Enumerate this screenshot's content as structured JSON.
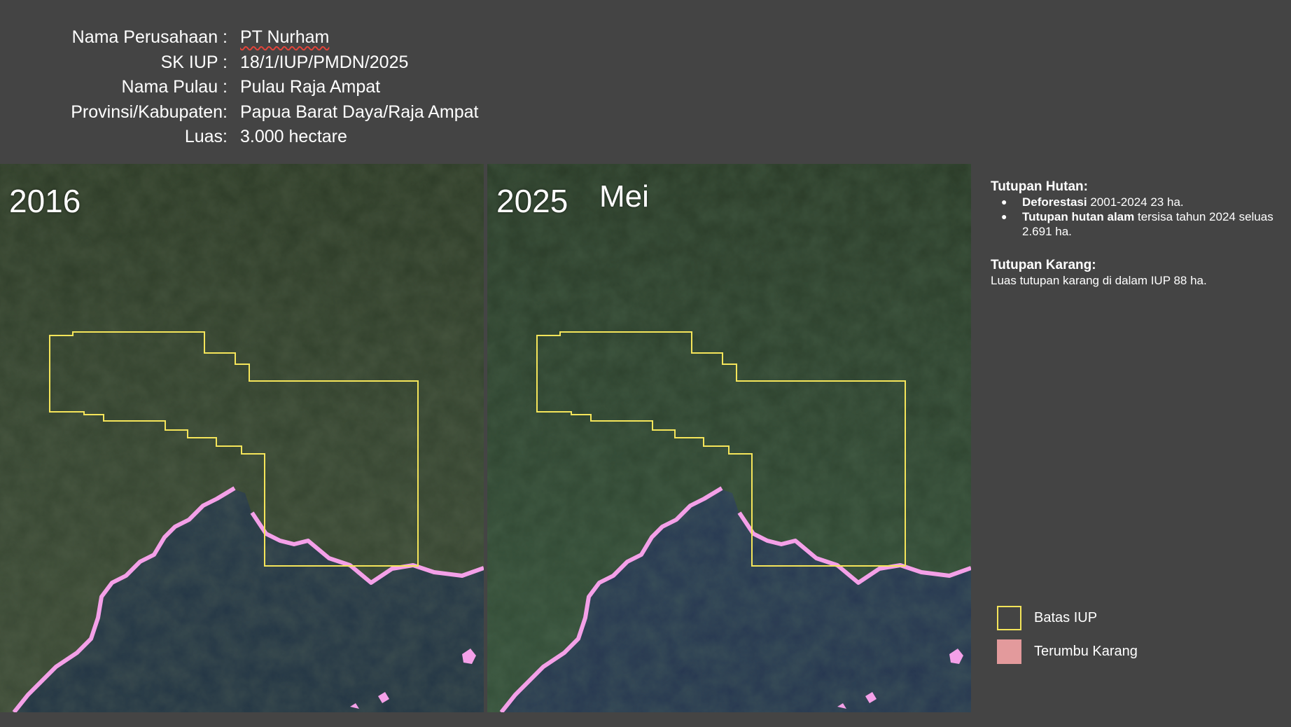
{
  "info": {
    "rows": [
      {
        "label": "Nama Perusahaan :",
        "value": "PT Nurham"
      },
      {
        "label": "SK IUP :",
        "value": "18/1/IUP/PMDN/2025"
      },
      {
        "label": "Nama Pulau :",
        "value": "Pulau Raja Ampat"
      },
      {
        "label": "Provinsi/Kabupaten:",
        "value": "Papua Barat Daya/Raja Ampat"
      },
      {
        "label": "Luas:",
        "value": "3.000 hectare"
      }
    ]
  },
  "maps": {
    "left": {
      "year": "2016"
    },
    "right": {
      "year": "2025",
      "month": "Mei"
    }
  },
  "forest": {
    "heading": "Tutupan Hutan:",
    "bullet": "●",
    "items": [
      {
        "bold": "Deforestasi",
        "text": " 2001-2024 23 ha."
      },
      {
        "bold": "Tutupan hutan alam",
        "text": " tersisa tahun 2024 seluas 2.691 ha."
      }
    ]
  },
  "coral": {
    "heading": "Tutupan Karang:",
    "text": "Luas tutupan karang di dalam IUP 88 ha."
  },
  "legend": {
    "iup_label": "Batas IUP",
    "coral_label": "Terumbu Karang"
  },
  "colors": {
    "background": "#444444",
    "iup_boundary": "#f5e55a",
    "coral": "#e39a9c",
    "coral_map": "#f4a0e8"
  }
}
